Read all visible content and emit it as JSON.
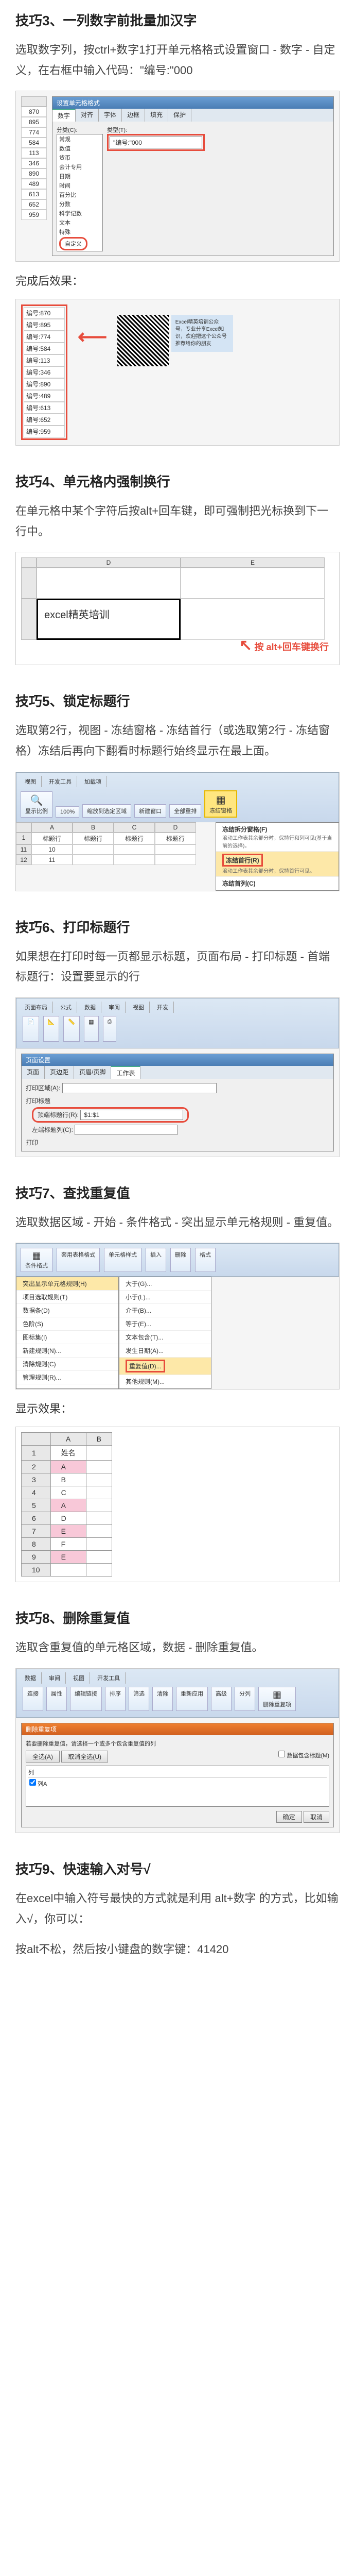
{
  "tip3": {
    "title": "技巧3、一列数字前批量加汉字",
    "text": "选取数字列，按ctrl+数字1打开单元格格式设置窗口 - 数字 - 自定义，在右框中输入代码：\"编号:\"000",
    "numbers": [
      "870",
      "895",
      "774",
      "584",
      "113",
      "346",
      "890",
      "489",
      "613",
      "652",
      "959"
    ],
    "dialog_title": "设置单元格格式",
    "tabs": [
      "数字",
      "对齐",
      "字体",
      "边框",
      "填充",
      "保护"
    ],
    "category_label": "分类(C):",
    "categories": [
      "常规",
      "数值",
      "货币",
      "会计专用",
      "日期",
      "时间",
      "百分比",
      "分数",
      "科学记数",
      "文本",
      "特殊",
      "自定义"
    ],
    "type_label": "类型(T):",
    "code": "\"编号:\"000",
    "result_label": "完成后效果：",
    "results": [
      "编号:870",
      "编号:895",
      "编号:774",
      "编号:584",
      "编号:113",
      "编号:346",
      "编号:890",
      "编号:489",
      "编号:613",
      "编号:652",
      "编号:959"
    ],
    "qr_text": "Excel精英培训公众号，专业分享Excel知识，欢迎把这个公众号推荐给你的朋友"
  },
  "tip4": {
    "title": "技巧4、单元格内强制换行",
    "text": "在单元格中某个字符后按alt+回车键，即可强制把光标换到下一行中。",
    "cell_text": "excel精英培训",
    "callout": "按 alt+回车键换行"
  },
  "tip5": {
    "title": "技巧5、锁定标题行",
    "text": "选取第2行，视图 - 冻结窗格 - 冻结首行（或选取第2行 - 冻结窗格）冻结后再向下翻看时标题行始终显示在最上面。",
    "ribbon_tabs": [
      "视图",
      "开发工具",
      "加载项"
    ],
    "ribbon_items": [
      "显示比例",
      "100%",
      "缩放到选定区域",
      "新建窗口",
      "全部重排",
      "冻结窗格"
    ],
    "menu_items": [
      "冻结拆分窗格(F)",
      "冻结首行(R)",
      "冻结首列(C)"
    ],
    "menu_desc1": "滚动工作表其余部分时，保持行和列可见(基于当前的选择)。",
    "menu_desc2": "滚动工作表其余部分时，保持首行可见。",
    "headers": [
      "标题行",
      "标题行",
      "标题行",
      "标题行"
    ],
    "data_row": [
      "10",
      "",
      "11",
      ""
    ]
  },
  "tip6": {
    "title": "技巧6、打印标题行",
    "text": "如果想在打印时每一页都显示标题，页面布局 - 打印标题 - 首端标题行：设置要显示的行",
    "ribbon_tabs": [
      "页面布局",
      "公式",
      "数据",
      "审阅",
      "视图",
      "开发"
    ],
    "dialog_title": "页面设置",
    "dialog_tabs": [
      "页面",
      "页边距",
      "页眉/页脚",
      "工作表"
    ],
    "print_area_label": "打印区域(A):",
    "print_titles_label": "打印标题",
    "top_row_label": "顶端标题行(R):",
    "top_row_value": "$1:$1",
    "left_col_label": "左端标题列(C):",
    "print_label": "打印"
  },
  "tip7": {
    "title": "技巧7、查找重复值",
    "text": "选取数据区域 - 开始 - 条件格式 - 突出显示单元格规则 - 重复值。",
    "ribbon_items": [
      "条件格式",
      "套用表格格式",
      "单元格样式",
      "插入",
      "删除",
      "格式"
    ],
    "menu1": [
      "突出显示单元格规则(H)",
      "项目选取规则(T)",
      "数据条(D)",
      "色阶(S)",
      "图标集(I)",
      "新建规则(N)...",
      "清除规则(C)",
      "管理规则(R)..."
    ],
    "menu2": [
      "大于(G)...",
      "小于(L)...",
      "介于(B)...",
      "等于(E)...",
      "文本包含(T)...",
      "发生日期(A)...",
      "重复值(D)...",
      "其他规则(M)..."
    ],
    "result_label": "显示效果：",
    "col_header": "姓名",
    "names": [
      "A",
      "B",
      "C",
      "A",
      "D",
      "E",
      "F",
      "E"
    ],
    "dup_rows": [
      1,
      4,
      5,
      8
    ]
  },
  "tip8": {
    "title": "技巧8、删除重复值",
    "text": "选取含重复值的单元格区域，数据 - 删除重复值。",
    "ribbon_tabs": [
      "数据",
      "审阅",
      "视图",
      "开发工具"
    ],
    "ribbon_items": [
      "连接",
      "属性",
      "编辑链接",
      "排序",
      "筛选",
      "清除",
      "重新应用",
      "高级",
      "分列",
      "删除重复项"
    ],
    "dialog_title": "删除重复项",
    "dialog_text": "若要删除重复值，请选择一个或多个包含重复值的列",
    "select_all": "全选(A)",
    "unselect_all": "取消全选(U)",
    "has_header": "数据包含标题(M)",
    "col_label": "列",
    "col_item": "列A",
    "ok": "确定",
    "cancel": "取消"
  },
  "tip9": {
    "title": "技巧9、快速输入对号√",
    "text1": "在excel中输入符号最快的方式就是利用 alt+数字 的方式，比如输入√，你可以：",
    "text2": "按alt不松，然后按小键盘的数字键：41420"
  }
}
